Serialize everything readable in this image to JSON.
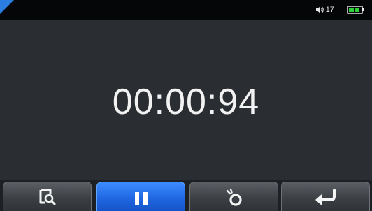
{
  "status_bar": {
    "volume_level": "17",
    "speaker_icon": "speaker-volume-icon",
    "battery_icon": "battery-icon",
    "battery_color": "#2fd13a",
    "accent_color": "#2a7de1"
  },
  "main": {
    "timer_value": "00:00:94"
  },
  "toolbar": {
    "buttons": [
      {
        "icon": "magnify-tag-icon",
        "active": false
      },
      {
        "icon": "pause-icon",
        "active": true
      },
      {
        "icon": "reset-icon",
        "active": false
      },
      {
        "icon": "back-arrow-icon",
        "active": false
      }
    ],
    "active_color": "#1f66e0"
  }
}
